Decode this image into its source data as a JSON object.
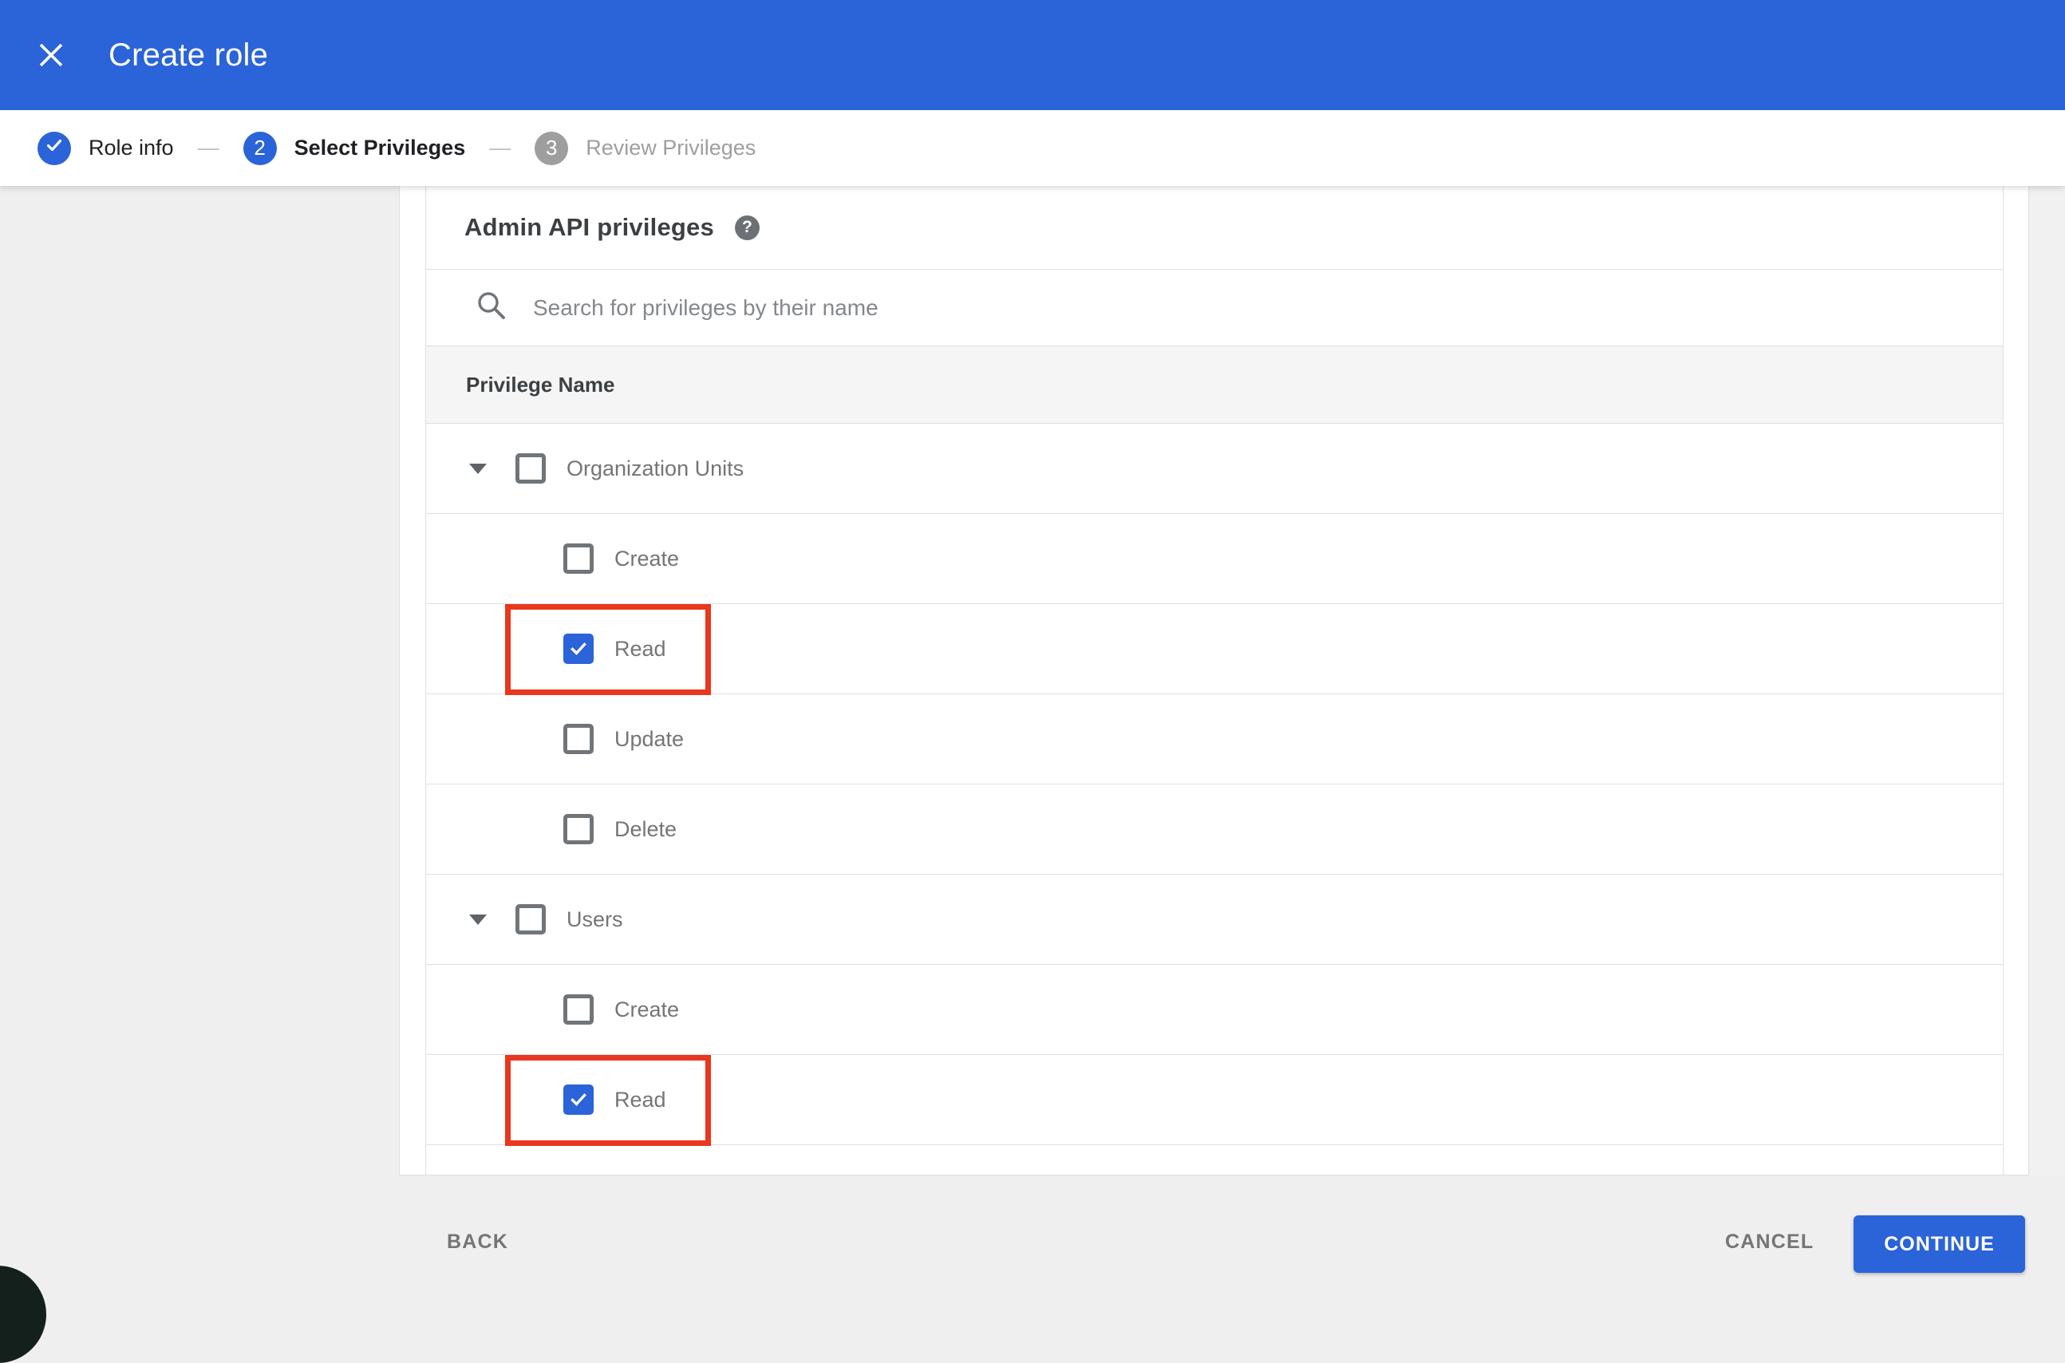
{
  "colors": {
    "primary_blue": "#2b63d8",
    "annotation_red": "#e8371d",
    "page_background": "#efefef",
    "row_border": "#e0e0e0",
    "table_header_background": "#f5f5f5"
  },
  "header": {
    "title": "Create role",
    "close_icon": "x-close"
  },
  "stepper": {
    "separator": "—",
    "steps": [
      {
        "num": "1",
        "label": "Role info",
        "state": "completed",
        "icon": "check"
      },
      {
        "num": "2",
        "label": "Select Privileges",
        "state": "active"
      },
      {
        "num": "3",
        "label": "Review Privileges",
        "state": "upcoming"
      }
    ]
  },
  "content": {
    "heading": "Admin API privileges",
    "help_icon": "?",
    "search_placeholder": "Search for privileges by their name",
    "column_header": "Privilege Name",
    "rows": [
      {
        "label": "Organization Units",
        "level": "parent",
        "expanded": true,
        "checked": false,
        "annotated": false
      },
      {
        "label": "Create",
        "level": "child",
        "checked": false,
        "annotated": false
      },
      {
        "label": "Read",
        "level": "child",
        "checked": true,
        "annotated": true
      },
      {
        "label": "Update",
        "level": "child",
        "checked": false,
        "annotated": false
      },
      {
        "label": "Delete",
        "level": "child",
        "checked": false,
        "annotated": false
      },
      {
        "label": "Users",
        "level": "parent",
        "expanded": true,
        "checked": false,
        "annotated": false
      },
      {
        "label": "Create",
        "level": "child",
        "checked": false,
        "annotated": false
      },
      {
        "label": "Read",
        "level": "child",
        "checked": true,
        "annotated": true
      }
    ]
  },
  "footer": {
    "back_label": "BACK",
    "cancel_label": "CANCEL",
    "continue_label": "CONTINUE"
  }
}
